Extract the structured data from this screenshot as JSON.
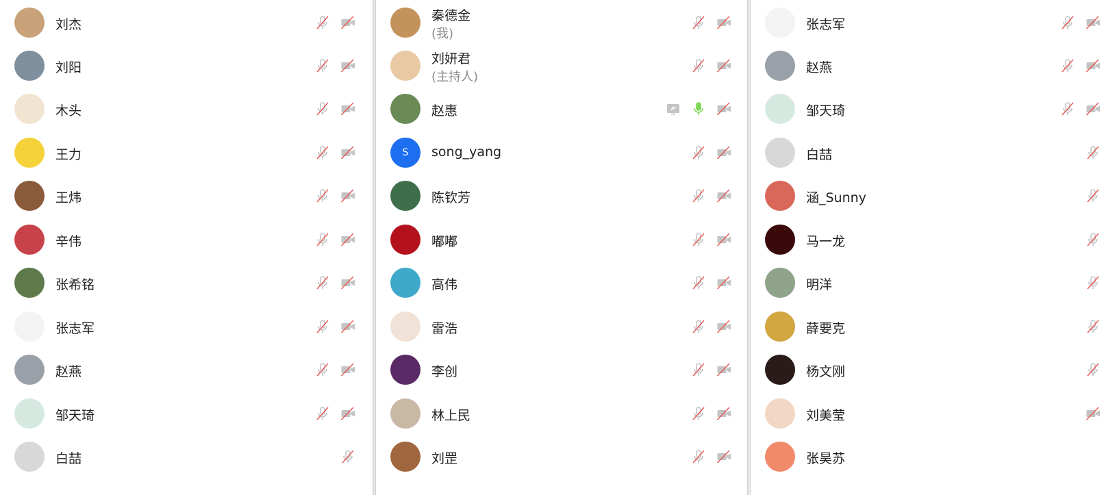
{
  "panels": [
    {
      "rows": [
        {
          "name": "刘杰",
          "avatar_icon": "donut-photo-avatar",
          "avatar_bg": "#c9a27a",
          "mic": "muted",
          "cam": "off"
        },
        {
          "name": "刘阳",
          "avatar_icon": "landscape-photo-avatar",
          "avatar_bg": "#7f8f9e",
          "mic": "muted",
          "cam": "off"
        },
        {
          "name": "木头",
          "avatar_icon": "cartoon-boy-avatar",
          "avatar_bg": "#f1e4d0",
          "mic": "muted",
          "cam": "off"
        },
        {
          "name": "王力",
          "avatar_icon": "psyduck-avatar",
          "avatar_bg": "#f5d23a",
          "mic": "muted",
          "cam": "off"
        },
        {
          "name": "王炜",
          "avatar_icon": "food-photo-avatar",
          "avatar_bg": "#8a5a3a",
          "mic": "muted",
          "cam": "off"
        },
        {
          "name": "辛伟",
          "avatar_icon": "red-building-avatar",
          "avatar_bg": "#c7424a",
          "mic": "muted",
          "cam": "off"
        },
        {
          "name": "张希铭",
          "avatar_icon": "outdoor-photo-avatar",
          "avatar_bg": "#5f7a4a",
          "mic": "muted",
          "cam": "off"
        },
        {
          "name": "张志军",
          "avatar_icon": "maple-leaf-avatar",
          "avatar_bg": "#f3f3f3",
          "mic": "muted",
          "cam": "off"
        },
        {
          "name": "赵燕",
          "avatar_icon": "child-photo-avatar",
          "avatar_bg": "#9aa0a8",
          "mic": "muted",
          "cam": "off"
        },
        {
          "name": "邹天琦",
          "avatar_icon": "puppy-avatar",
          "avatar_bg": "#d6e9e0",
          "mic": "muted",
          "cam": "off"
        },
        {
          "name": "白喆",
          "avatar_icon": "child-standing-avatar",
          "avatar_bg": "#d8d8d8",
          "mic": "muted",
          "cam": "none"
        }
      ]
    },
    {
      "rows": [
        {
          "name": "秦德金",
          "sub": "(我)",
          "avatar_icon": "person-photo-avatar",
          "avatar_bg": "#c4925c",
          "mic": "muted",
          "cam": "off"
        },
        {
          "name": "刘妍君",
          "sub": "(主持人)",
          "avatar_icon": "woman-photo-avatar",
          "avatar_bg": "#e8c9a4",
          "mic": "muted",
          "cam": "off"
        },
        {
          "name": "赵惠",
          "avatar_icon": "kid-photo-avatar",
          "avatar_bg": "#6a8a56",
          "mic": "active",
          "cam": "off",
          "share": true
        },
        {
          "name": "song_yang",
          "avatar_icon": "letter-avatar",
          "avatar_letter": "S",
          "avatar_bg": "#1e6ff0",
          "mic": "muted",
          "cam": "off"
        },
        {
          "name": "陈钦芳",
          "avatar_icon": "flower-painting-avatar",
          "avatar_bg": "#3f6e4a",
          "mic": "muted",
          "cam": "off"
        },
        {
          "name": "嘟嘟",
          "avatar_icon": "roses-avatar",
          "avatar_bg": "#b3121d",
          "mic": "muted",
          "cam": "off"
        },
        {
          "name": "高伟",
          "avatar_icon": "beach-avatar",
          "avatar_bg": "#3fa9c9",
          "mic": "muted",
          "cam": "off"
        },
        {
          "name": "雷浩",
          "avatar_icon": "anime-avatar",
          "avatar_bg": "#f0e2d6",
          "mic": "muted",
          "cam": "off"
        },
        {
          "name": "李创",
          "avatar_icon": "orchid-avatar",
          "avatar_bg": "#5a2a66",
          "mic": "muted",
          "cam": "off"
        },
        {
          "name": "林上民",
          "avatar_icon": "tea-cup-avatar",
          "avatar_bg": "#c9b8a4",
          "mic": "muted",
          "cam": "off"
        },
        {
          "name": "刘罡",
          "avatar_icon": "desert-avatar",
          "avatar_bg": "#a0663e",
          "mic": "muted",
          "cam": "off"
        }
      ]
    },
    {
      "rows": [
        {
          "name": "张志军",
          "avatar_icon": "maple-leaf-avatar",
          "avatar_bg": "#f3f3f3",
          "mic": "muted",
          "cam": "off"
        },
        {
          "name": "赵燕",
          "avatar_icon": "child-photo-avatar",
          "avatar_bg": "#9aa0a8",
          "mic": "muted",
          "cam": "off"
        },
        {
          "name": "邹天琦",
          "avatar_icon": "puppy-avatar",
          "avatar_bg": "#d6e9e0",
          "mic": "muted",
          "cam": "off"
        },
        {
          "name": "白喆",
          "avatar_icon": "child-standing-avatar",
          "avatar_bg": "#d8d8d8",
          "mic": "muted",
          "cam": "none"
        },
        {
          "name": "涵_Sunny",
          "avatar_icon": "red-cartoon-avatar",
          "avatar_bg": "#d9685a",
          "mic": "muted",
          "cam": "none"
        },
        {
          "name": "马一龙",
          "avatar_icon": "emblem-avatar",
          "avatar_bg": "#3a0a0a",
          "mic": "muted",
          "cam": "none"
        },
        {
          "name": "明洋",
          "avatar_icon": "plant-avatar",
          "avatar_bg": "#8fa38a",
          "mic": "muted",
          "cam": "none"
        },
        {
          "name": "薛要克",
          "avatar_icon": "autumn-trees-avatar",
          "avatar_bg": "#d2a640",
          "mic": "muted",
          "cam": "none"
        },
        {
          "name": "杨文刚",
          "avatar_icon": "temple-night-avatar",
          "avatar_bg": "#2a1a1a",
          "mic": "muted",
          "cam": "none"
        },
        {
          "name": "刘美莹",
          "avatar_icon": "girl-illustration-avatar",
          "avatar_bg": "#f2d7c4",
          "mic": "none",
          "cam": "off"
        },
        {
          "name": "张昊苏",
          "avatar_icon": "child-red-avatar",
          "avatar_bg": "#f08a6a",
          "mic": "none",
          "cam": "none"
        }
      ]
    }
  ],
  "colors": {
    "text": "#222222",
    "sub_text": "#8a8a8a",
    "icon_gray": "#c4c4c4",
    "mute_slash": "#e85a5a",
    "mic_active": "#7ed957"
  }
}
